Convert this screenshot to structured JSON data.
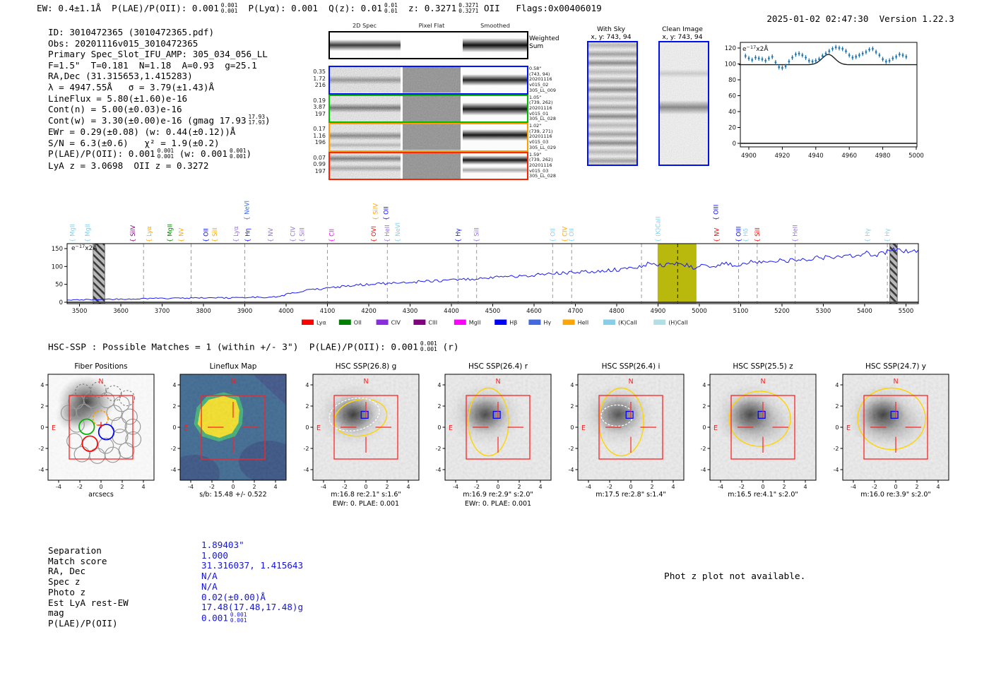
{
  "header": {
    "segments": [
      {
        "t": "EW: 0.4±1.1Å  P(LAE)/P(OII): 0.001"
      },
      {
        "f": [
          "0.001",
          "0.001"
        ]
      },
      {
        "t": "  P(Lyα): 0.001  Q(z): 0.01"
      },
      {
        "f": [
          "0.01",
          "0.01"
        ]
      },
      {
        "t": "  z: 0.3271"
      },
      {
        "f": [
          "0.3271",
          "0.3271"
        ]
      },
      {
        "t": " OII   Flags:0x00406019"
      }
    ],
    "datetime": "2025-01-02 02:47:30",
    "version": "Version 1.22.3"
  },
  "info": {
    "lines": [
      [
        {
          "t": "ID: 3010472365 (3010472365.pdf)"
        }
      ],
      [
        {
          "t": "Obs: 20201116v015_3010472365"
        }
      ],
      [
        {
          "t": "Primary Spec_Slot_IFU_AMP: 305_034_056_LL"
        }
      ],
      [
        {
          "t": "F=1.5\"  T=0.181  N=1.18  A=0.93  g=25.1"
        }
      ],
      [
        {
          "t": "RA,Dec (31.315653,1.415283)"
        }
      ],
      [
        {
          "t": "λ = 4947.55Å   σ = 3.79(±1.43)Å"
        }
      ],
      [
        {
          "t": "LineFlux = 5.80(±1.60)e-16"
        }
      ],
      [
        {
          "t": "Cont(n) = 5.00(±0.03)e-16"
        }
      ],
      [
        {
          "t": "Cont(w) = 3.30(±0.00)e-16 (gmag 17.93"
        },
        {
          "f": [
            "17.93",
            "17.93"
          ]
        },
        {
          "t": ")"
        }
      ],
      [
        {
          "t": "EWr = 0.29(±0.08) (w: 0.44(±0.12))Å"
        }
      ],
      [
        {
          "t": "S/N = 6.3(±0.6)   χ² = 1.9(±0.2)"
        }
      ],
      [
        {
          "t": "P(LAE)/P(OII): 0.001"
        },
        {
          "f": [
            "0.001",
            "0.001"
          ]
        },
        {
          "t": " (w: 0.001"
        },
        {
          "f": [
            "0.001",
            "0.001"
          ]
        },
        {
          "t": ")"
        }
      ],
      [
        {
          "t": "LyA z = 3.0698  OII z = 0.3272"
        }
      ]
    ]
  },
  "spec2d": {
    "col_titles": [
      "2D Spec",
      "Pixel Flat",
      "Smoothed"
    ],
    "weighted_label_1": "Weighted",
    "weighted_label_2": "Sum",
    "rows": [
      {
        "color": "#0013ff",
        "left": [
          "0.35",
          "1.72",
          "216"
        ],
        "right": [
          "0.58\"",
          "(743, 94)",
          "20201116",
          "v015_02",
          "305_LL_009"
        ]
      },
      {
        "color": "#00bb00",
        "left": [
          "0.19",
          "3.87",
          "197"
        ],
        "right": [
          "1.05\"",
          "(739, 262)",
          "20201116",
          "v015_01",
          "305_LL_028"
        ]
      },
      {
        "color": "#ff9d00",
        "left": [
          "0.17",
          "1.16",
          "196"
        ],
        "right": [
          "1.02\"",
          "(739, 271)",
          "20201116",
          "v015_03",
          "305_LL_029"
        ]
      },
      {
        "color": "#ff2200",
        "left": [
          "0.07",
          "0.99",
          "197"
        ],
        "right": [
          "1.59\"",
          "(739, 262)",
          "20201116",
          "v015_03",
          "305_LL_028"
        ]
      }
    ]
  },
  "sky_panels": [
    {
      "title": "With Sky",
      "subtitle": "x, y: 743, 94"
    },
    {
      "title": "Clean Image",
      "subtitle": "x, y: 743, 94"
    }
  ],
  "hsc_line": {
    "segments": [
      {
        "t": "HSC-SSP : Possible Matches = 1 (within +/- 3\")  P(LAE)/P(OII): 0.001"
      },
      {
        "f": [
          "0.001",
          "0.001"
        ]
      },
      {
        "t": " (r)"
      }
    ]
  },
  "chart_data": [
    {
      "type": "scatter",
      "title": "emission line fit cutout",
      "unit_label": "e-17x2Å",
      "xlim": [
        4894,
        5001
      ],
      "ylim": [
        -5,
        127
      ],
      "xticks": [
        4900,
        4920,
        4940,
        4960,
        4980,
        5000
      ],
      "yticks": [
        0,
        20,
        40,
        60,
        80,
        100,
        120
      ],
      "point_color": "#1f77b4",
      "points_x0": 4898,
      "points_dx": 2,
      "points_y": [
        110,
        107,
        105,
        108,
        107,
        106,
        104,
        107,
        109,
        102,
        96,
        95,
        97,
        103,
        108,
        112,
        113,
        111,
        108,
        104,
        103,
        104,
        106,
        110,
        113,
        116,
        119,
        121,
        120,
        119,
        116,
        111,
        108,
        109,
        111,
        113,
        115,
        118,
        119,
        115,
        111,
        106,
        103,
        104,
        107,
        109,
        112,
        111,
        109
      ],
      "yerr": 3,
      "fit": {
        "baseline": 99,
        "amplitude": 13,
        "center": 4947.55,
        "sigma": 3.79,
        "color": "#1c1c1c"
      }
    },
    {
      "type": "line",
      "title": "full spectrum",
      "unit_label": "e-17x2Å",
      "xlim": [
        3470,
        5530
      ],
      "ylim": [
        0,
        164
      ],
      "yticks": [
        0,
        50,
        100,
        150
      ],
      "xticks": [
        3500,
        3600,
        3700,
        3800,
        3900,
        4000,
        4100,
        4200,
        4300,
        4400,
        4500,
        4600,
        4700,
        4800,
        4900,
        5000,
        5100,
        5200,
        5300,
        5400,
        5500
      ],
      "line_color": "#1a1aff",
      "anchors_x": [
        3470,
        3560,
        3620,
        3680,
        3740,
        3800,
        3860,
        3920,
        3960,
        3990,
        4010,
        4050,
        4100,
        4150,
        4200,
        4250,
        4300,
        4350,
        4400,
        4450,
        4500,
        4550,
        4600,
        4650,
        4700,
        4750,
        4800,
        4840,
        4880,
        4910,
        4940,
        4960,
        4985,
        5000,
        5030,
        5060,
        5090,
        5120,
        5160,
        5200,
        5240,
        5280,
        5320,
        5360,
        5400,
        5440,
        5470,
        5530
      ],
      "anchors_y": [
        6,
        8,
        9,
        11,
        11,
        13,
        12,
        14,
        13,
        18,
        26,
        33,
        40,
        46,
        50,
        53,
        56,
        59,
        62,
        65,
        69,
        72,
        76,
        80,
        83,
        87,
        91,
        96,
        108,
        102,
        110,
        108,
        96,
        104,
        100,
        108,
        103,
        112,
        110,
        118,
        116,
        124,
        126,
        130,
        136,
        134,
        146,
        144
      ],
      "highlight_band": {
        "x0": 4899,
        "x1": 4993,
        "color": "#b5b500"
      },
      "hatch_bands": [
        [
          3533,
          3561
        ],
        [
          5461,
          5479
        ]
      ],
      "emission_line_marker": 4947.55,
      "dashed_lines": [
        3655,
        3770,
        3900,
        4100,
        4245,
        4416,
        4461,
        4645,
        4691,
        4860,
        5095,
        5140,
        5232,
        5455
      ],
      "line_labels": [
        [
          3483,
          "MgII",
          "#87ceeb",
          0
        ],
        [
          3520,
          "MgII",
          "#87ceeb",
          0
        ],
        [
          3629,
          "SiIV",
          "#800080",
          0
        ],
        [
          3668,
          "Lyα",
          "#ffa500",
          0
        ],
        [
          3719,
          "MgII",
          "#008000",
          0
        ],
        [
          3746,
          "NV",
          "#ffa500",
          0
        ],
        [
          3806,
          "OII",
          "#0000ff",
          0
        ],
        [
          3827,
          "SiII",
          "#ffa500",
          0
        ],
        [
          3879,
          "Lyα",
          "#9370db",
          0
        ],
        [
          3907,
          "Hη",
          "#0000ff",
          0
        ],
        [
          3905,
          "NeVI",
          "#4169e1",
          1
        ],
        [
          3962,
          "NV",
          "#9370db",
          0
        ],
        [
          4016,
          "CIV",
          "#9370db",
          0
        ],
        [
          4038,
          "SiII",
          "#9370db",
          0
        ],
        [
          4110,
          "CII",
          "#ff00ff",
          0
        ],
        [
          4212,
          "OVI",
          "#ff0000",
          0
        ],
        [
          4216,
          "SiIV",
          "#ffa500",
          1
        ],
        [
          4244,
          "HeII",
          "#9370db",
          0
        ],
        [
          4242,
          "OII",
          "#0000ff",
          1
        ],
        [
          4270,
          "NeVI",
          "#87ceeb",
          0
        ],
        [
          4416,
          "Hγ",
          "#0000ff",
          0
        ],
        [
          4461,
          "SiII",
          "#9370db",
          0
        ],
        [
          4645,
          "OII",
          "#87ceeb",
          0
        ],
        [
          4674,
          "CIV",
          "#ffa500",
          0
        ],
        [
          4691,
          "OII",
          "#87ceeb",
          0
        ],
        [
          4900,
          "(K)CaII",
          "#87ceeb",
          0
        ],
        [
          5042,
          "NV",
          "#ff0000",
          0
        ],
        [
          5040,
          "OIII",
          "#0000ff",
          1
        ],
        [
          5095,
          "OIII",
          "#0000ff",
          0
        ],
        [
          5112,
          "Hδ",
          "#87ceeb",
          0
        ],
        [
          5140,
          "SiII",
          "#ff0000",
          0
        ],
        [
          5232,
          "HeII",
          "#9370db",
          0
        ],
        [
          5407,
          "Hγ",
          "#87ceeb",
          0
        ],
        [
          5455,
          "Hγ",
          "#87ceeb",
          0
        ]
      ],
      "legend": [
        [
          "Lyα",
          "#ff0000"
        ],
        [
          "OII",
          "#008000"
        ],
        [
          "CIV",
          "#8a2be2"
        ],
        [
          "CIII",
          "#800080"
        ],
        [
          "MgII",
          "#ff00ff"
        ],
        [
          "Hβ",
          "#0000ff"
        ],
        [
          "Hγ",
          "#4169e1"
        ],
        [
          "HeII",
          "#ffa500"
        ],
        [
          "(K)CaII",
          "#87ceeb"
        ],
        [
          "(H)CaII",
          "#b0e0e6"
        ]
      ]
    }
  ],
  "cutouts": {
    "axis_ticks": [
      -4,
      -2,
      0,
      2,
      4
    ],
    "north": "N",
    "east": "E",
    "panels": [
      {
        "id": "fiber",
        "title": "Fiber Positions",
        "caption1": "arcsecs",
        "caption2": ""
      },
      {
        "id": "lineflux",
        "title": "Lineflux Map",
        "caption1": "s/b: 15.48 +/- 0.522",
        "caption2": ""
      },
      {
        "id": "g",
        "title": "HSC SSP(26.8) g",
        "caption1": "m:16.8  re:2.1\"  s:1.6\"",
        "caption2": "EWr: 0. PLAE: 0.001"
      },
      {
        "id": "r",
        "title": "HSC SSP(26.4) r",
        "caption1": "m:16.9  re:2.9\"  s:2.0\"",
        "caption2": "EWr: 0. PLAE: 0.001"
      },
      {
        "id": "i",
        "title": "HSC SSP(26.4) i",
        "caption1": "m:17.5  re:2.8\"  s:1.4\"",
        "caption2": ""
      },
      {
        "id": "z",
        "title": "HSC SSP(25.5) z",
        "caption1": "m:16.5  re:4.1\"  s:2.0\"",
        "caption2": ""
      },
      {
        "id": "y",
        "title": "HSC SSP(24.7) y",
        "caption1": "m:16.0  re:3.9\"  s:2.0\"",
        "caption2": ""
      }
    ]
  },
  "match_table": {
    "value_color": "#1414e0",
    "rows": [
      {
        "label": "Separation",
        "value": "1.89403\""
      },
      {
        "label": "Match score",
        "value": "1.000"
      },
      {
        "label": "RA, Dec",
        "value": "31.316037, 1.415643"
      },
      {
        "label": "Spec z",
        "value": "N/A"
      },
      {
        "label": "Photo z",
        "value": "N/A"
      },
      {
        "label": "Est LyA rest-EW",
        "value": "0.02(±0.00)Å"
      },
      {
        "label": "mag",
        "value": "17.48(17.48,17.48)g"
      },
      {
        "label": "P(LAE)/P(OII)",
        "value": "0.001",
        "frac": [
          "0.001",
          "0.001"
        ]
      }
    ],
    "note": "Phot z plot not available."
  }
}
